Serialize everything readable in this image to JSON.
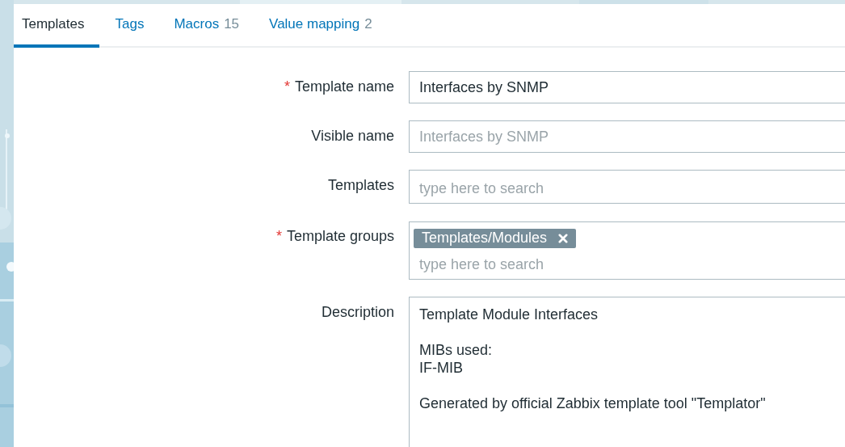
{
  "tabs": [
    {
      "label": "Templates",
      "selected": true
    },
    {
      "label": "Tags",
      "selected": false
    },
    {
      "label": "Macros",
      "count": "15",
      "selected": false
    },
    {
      "label": "Value mapping",
      "count": "2",
      "selected": false
    }
  ],
  "form": {
    "fields": [
      {
        "kind": "text",
        "marker": "*",
        "label": "Template name",
        "value": "Interfaces by SNMP"
      },
      {
        "kind": "text",
        "label": "Visible name",
        "placeholder": "Interfaces by SNMP"
      },
      {
        "kind": "multiselect",
        "label": "Templates",
        "placeholder": "type here to search"
      },
      {
        "kind": "multiselect",
        "marker": "*",
        "label": "Template groups",
        "chips": [
          "Templates/Modules"
        ],
        "placeholder": "type here to search"
      },
      {
        "kind": "textarea",
        "label": "Description",
        "value": "Template Module Interfaces\n\nMIBs used:\nIF-MIB\n\nGenerated by official Zabbix template tool \"Templator\""
      }
    ]
  }
}
